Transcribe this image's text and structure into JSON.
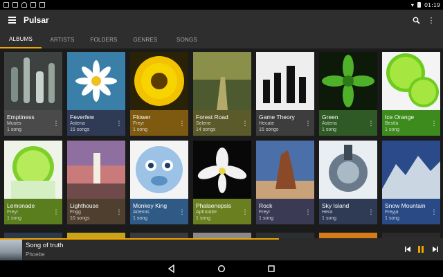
{
  "status": {
    "time": "01:19",
    "icons": [
      "notification-icon",
      "sim-icon",
      "android-icon",
      "shop-icon",
      "play-store-icon"
    ],
    "right_icons": [
      "wifi-icon",
      "battery-icon"
    ]
  },
  "appbar": {
    "title": "Pulsar",
    "search_icon": "search-icon",
    "more_icon": "more-vert-icon"
  },
  "tabs": [
    {
      "label": "ALBUMS",
      "active": true
    },
    {
      "label": "ARTISTS"
    },
    {
      "label": "FOLDERS"
    },
    {
      "label": "GENRES"
    },
    {
      "label": "SONGS"
    }
  ],
  "albums": [
    {
      "title": "Emptiness",
      "artist": "Muses",
      "count": "1 song",
      "color": "#4a4a4a"
    },
    {
      "title": "Feverfew",
      "artist": "Asteria",
      "count": "15 songs",
      "color": "#2f3a55"
    },
    {
      "title": "Flower",
      "artist": "Freyr",
      "count": "1 song",
      "color": "#7d5a10"
    },
    {
      "title": "Forest Road",
      "artist": "Selene",
      "count": "14 songs",
      "color": "#5a5a2a"
    },
    {
      "title": "Game Theory",
      "artist": "Hecate",
      "count": "15 songs",
      "color": "#3d3d3d"
    },
    {
      "title": "Green",
      "artist": "Asteria",
      "count": "1 song",
      "color": "#2f5a25"
    },
    {
      "title": "Ice Orange",
      "artist": "Bestla",
      "count": "1 song",
      "color": "#3d8a1d"
    },
    {
      "title": "Lemonade",
      "artist": "Freyr",
      "count": "1 song",
      "color": "#5a7d1d"
    },
    {
      "title": "Lighthouse",
      "artist": "Frigg",
      "count": "10 songs",
      "color": "#4f3f2f"
    },
    {
      "title": "Monkey King",
      "artist": "Artemis",
      "count": "1 song",
      "color": "#2f5a85"
    },
    {
      "title": "Phalaenopsis",
      "artist": "Aphrodite",
      "count": "1 song",
      "color": "#6a8020"
    },
    {
      "title": "Rock",
      "artist": "Freyr",
      "count": "1 song",
      "color": "#3a3a55"
    },
    {
      "title": "Sky Island",
      "artist": "Hera",
      "count": "1 song",
      "color": "#2f3a55"
    },
    {
      "title": "Snow Mountain",
      "artist": "Freyja",
      "count": "1 song",
      "color": "#2a4a85"
    }
  ],
  "now_playing": {
    "title": "Song of truth",
    "artist": "Phoebe",
    "progress": 0.63
  },
  "colors": {
    "accent": "#f0a400",
    "appbar": "#2e2e2e",
    "background": "#1b1b1b"
  }
}
